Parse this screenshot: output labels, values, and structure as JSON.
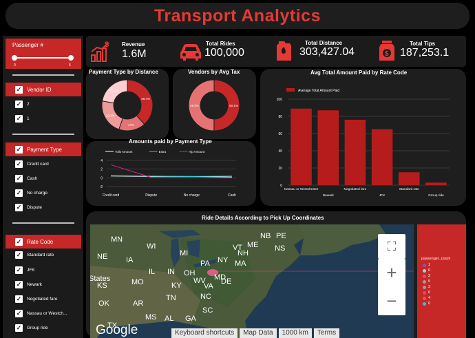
{
  "title": "Transport Analytics",
  "sidebar": {
    "slider": {
      "title": "Passenger #",
      "min": "0",
      "max": "6"
    },
    "vendor": {
      "title": "Vendor ID",
      "items": [
        "2",
        "1"
      ]
    },
    "payment": {
      "title": "Payment Type",
      "items": [
        "Credit card",
        "Cash",
        "No charge",
        "Dispute"
      ]
    },
    "rate": {
      "title": "Rate Code",
      "items": [
        "Standard rate",
        "JFK",
        "Newark",
        "Negotiated fare",
        "Nassau or Westch...",
        "Group ride"
      ]
    }
  },
  "kpis": {
    "revenue": {
      "label": "Revenue",
      "value": "1.6M"
    },
    "rides": {
      "label": "Total Rides",
      "value": "100,000"
    },
    "distance": {
      "label": "Total Distance",
      "value": "303,427.04"
    },
    "tips": {
      "label": "Total Tips",
      "value": "187,253.1"
    }
  },
  "colors": {
    "accent": "#c62828",
    "title": "#e53935",
    "panel": "#1e1e1e"
  },
  "charts": {
    "payment_title": "Payment Type by Distance",
    "vendors_title": "Vendors by Avg Tax",
    "amounts_title": "Amounts paid by Payment Type",
    "rate_title": "Avg Total Amount Paid by Rate Code",
    "map_title": "Ride Details According to Pick Up Coordinates"
  },
  "chart_data": [
    {
      "type": "pie",
      "title": "Payment Type by Distance",
      "categories": [
        "Credit card",
        "Cash",
        "No charge",
        "Dispute"
      ],
      "values": [
        38.4,
        17,
        22.3,
        22.3
      ],
      "labels": [
        "38.4%",
        "17%",
        "22.3%",
        "22.3%"
      ],
      "colors": [
        "#c62828",
        "#e57373",
        "#ef9a9a",
        "#ffcdd2"
      ]
    },
    {
      "type": "pie",
      "title": "Vendors by Avg Tax",
      "categories": [
        "2",
        "1"
      ],
      "values": [
        50.1,
        49.9
      ],
      "labels": [
        "50.1%",
        "49.9%"
      ],
      "colors": [
        "#c62828",
        "#e57373"
      ]
    },
    {
      "type": "line",
      "title": "Amounts paid by Payment Type",
      "categories": [
        "Credit card",
        "Dispute",
        "No charge",
        "Cash"
      ],
      "series": [
        {
          "name": "Tolls Amount",
          "values": [
            0.4,
            0.3,
            0.3,
            0.2
          ],
          "color": "#ffffff"
        },
        {
          "name": "Extra",
          "values": [
            0.5,
            0.4,
            0.3,
            0.4
          ],
          "color": "#26c6da"
        },
        {
          "name": "Tip Amount",
          "values": [
            3,
            0.1,
            0.1,
            0
          ],
          "color": "#e91e8c"
        }
      ],
      "yticks": [
        4,
        2,
        0,
        -2
      ],
      "ylim": [
        -2,
        4
      ]
    },
    {
      "type": "bar",
      "title": "Avg Total Amount Paid by Rate Code",
      "legend": "Average Total Amount Paid",
      "categories": [
        "Nassau or Westchester",
        "Newark",
        "Negotiated fare",
        "JFK",
        "Standard rate",
        "Group ride"
      ],
      "values": [
        89,
        87,
        76,
        65,
        15,
        3
      ],
      "yticks": [
        100,
        80,
        60,
        40,
        20,
        0
      ],
      "ylim": [
        0,
        100
      ]
    }
  ],
  "map": {
    "legend_title": "passenger_count",
    "legend_items": [
      {
        "label": "1",
        "color": "#7e57c2"
      },
      {
        "label": "0",
        "color": "#80deea"
      },
      {
        "label": "2",
        "color": "#ec407a"
      },
      {
        "label": "5",
        "color": "#9e9e9e"
      },
      {
        "label": "3",
        "color": "#9e9e9e"
      },
      {
        "label": "6",
        "color": "#ec407a"
      },
      {
        "label": "4",
        "color": "#ef5350"
      },
      {
        "label": "0",
        "color": "#26c6da"
      }
    ],
    "places": [
      "MN",
      "WI",
      "MI",
      "IA",
      "IL",
      "IN",
      "OH",
      "MO",
      "KY",
      "WV",
      "PA",
      "NY",
      "VT",
      "NH",
      "ME",
      "NB",
      "PE",
      "NS",
      "MA",
      "OK",
      "AR",
      "TN",
      "NC",
      "MS",
      "AL",
      "GA",
      "SC",
      "VA",
      "MD",
      "DE",
      "NE",
      "KS",
      "TX",
      "States"
    ],
    "google": "Google",
    "footer": [
      "Keyboard shortcuts",
      "Map Data",
      "1000 km",
      "Terms"
    ]
  }
}
